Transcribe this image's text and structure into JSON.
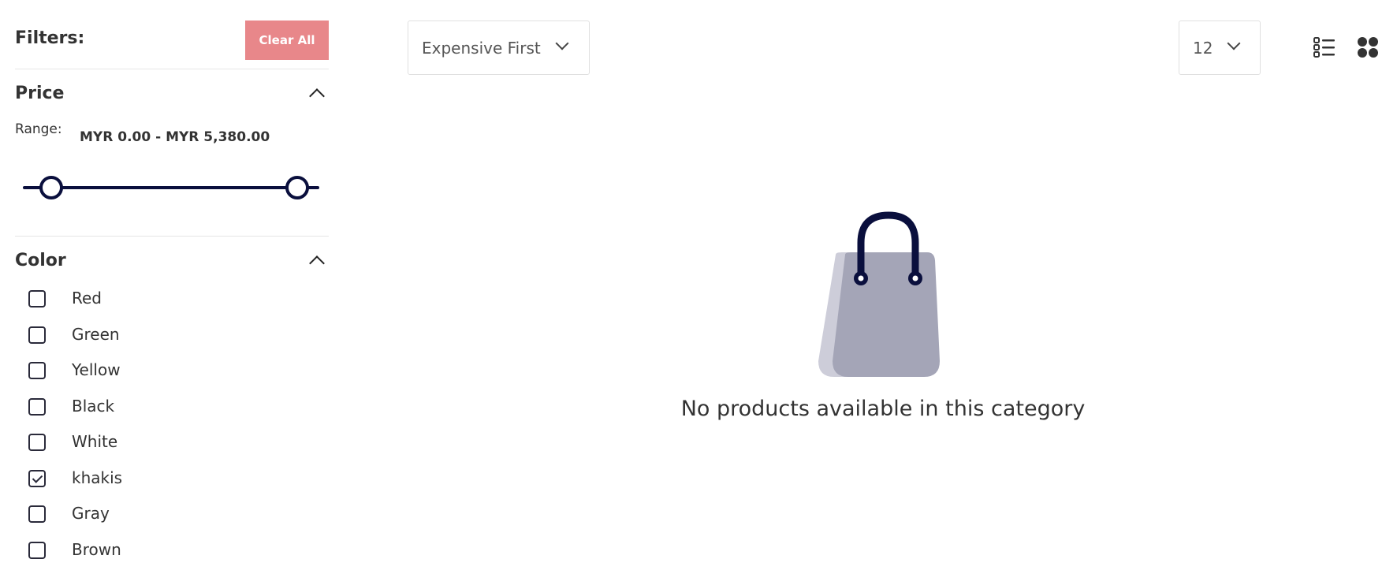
{
  "filters": {
    "title": "Filters:",
    "clear_all_label": "Clear All"
  },
  "price": {
    "title": "Price",
    "range_label": "Range:",
    "range_value": "MYR 0.00 - MYR 5,380.00"
  },
  "color": {
    "title": "Color",
    "options": [
      {
        "label": "Red",
        "checked": false
      },
      {
        "label": "Green",
        "checked": false
      },
      {
        "label": "Yellow",
        "checked": false
      },
      {
        "label": "Black",
        "checked": false
      },
      {
        "label": "White",
        "checked": false
      },
      {
        "label": "khakis",
        "checked": true
      },
      {
        "label": "Gray",
        "checked": false
      },
      {
        "label": "Brown",
        "checked": false
      }
    ]
  },
  "toolbar": {
    "sort_value": "Expensive First",
    "per_page_value": "12"
  },
  "empty": {
    "message": "No products available in this category"
  },
  "colors": {
    "accent_dark": "#0a0f3d",
    "clear_button": "#e8878a",
    "bag_body": "#a4a5b7",
    "bag_shadow": "#cdcdd9"
  },
  "icons": {
    "list_view": "list-view-icon",
    "grid_view": "grid-view-icon",
    "empty_bag": "shopping-bag-icon"
  }
}
